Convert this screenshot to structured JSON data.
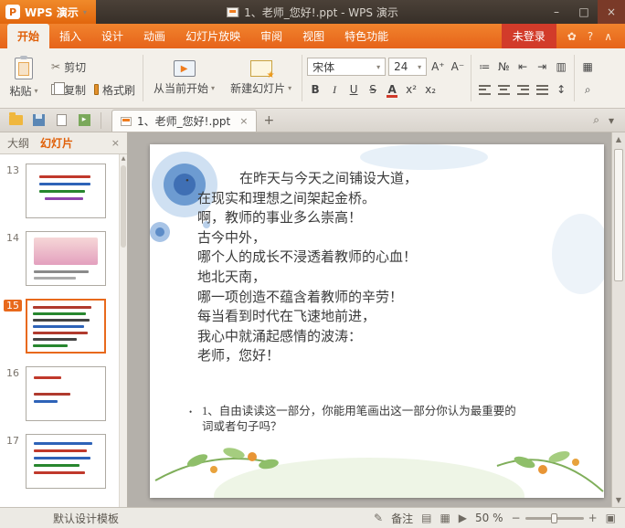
{
  "titlebar": {
    "logo_text": "WPS 演示",
    "title": "1、老师_您好!.ppt - WPS 演示"
  },
  "window": {
    "minimize": "–",
    "maximize": "□",
    "close": "×"
  },
  "ribbon_tabs": {
    "items": [
      "开始",
      "插入",
      "设计",
      "动画",
      "幻灯片放映",
      "审阅",
      "视图",
      "特色功能"
    ],
    "login": "未登录"
  },
  "toolbar": {
    "paste": "粘贴",
    "cut": "剪切",
    "copy": "复制",
    "format_painter": "格式刷",
    "from_current": "从当前开始",
    "new_slide": "新建幻灯片",
    "font_name": "宋体",
    "font_size": "24"
  },
  "glyphs": {
    "logo_p": "P",
    "caret_down": "▾",
    "collapse": "∧",
    "skin": "✿",
    "help": "?",
    "cut": "✂",
    "play": "▶",
    "font_bigger": "A⁺",
    "font_smaller": "A⁻",
    "bold": "B",
    "italic": "I",
    "underline": "U",
    "strike": "S",
    "font_color": "A",
    "superscript": "x²",
    "subscript": "x₂",
    "bullets": "≔",
    "numbering": "№",
    "indent_dec": "⇤",
    "indent_inc": "⇥",
    "columns": "▥",
    "line_spacing": "↕",
    "layout": "▦",
    "find": "⌕",
    "scroll_up": "▲",
    "scroll_down": "▼",
    "notes": "✎",
    "view_normal": "▤",
    "view_sorter": "▦",
    "view_play": "▶",
    "zoom_minus": "−",
    "zoom_plus": "+",
    "fit": "▣",
    "new_tab": "+",
    "close_small": "×",
    "export_arrow": "▸"
  },
  "docbar": {
    "tab_title": "1、老师_您好!.ppt"
  },
  "sidebar": {
    "tab_outline": "大纲",
    "tab_slides": "幻灯片",
    "close": "×",
    "thumbnails": [
      {
        "number": "13"
      },
      {
        "number": "14"
      },
      {
        "number": "15"
      },
      {
        "number": "16"
      },
      {
        "number": "17"
      }
    ]
  },
  "slide": {
    "bullet": "•",
    "lines": [
      "在昨天与今天之间铺设大道，",
      "在现实和理想之间架起金桥。",
      "啊，教师的事业多么崇高！",
      "古今中外，",
      "哪个人的成长不浸透着教师的心血！",
      "地北天南，",
      "哪一项创造不蕴含着教师的辛劳！",
      "每当看到时代在飞速地前进，",
      "我心中就涌起感情的波涛：",
      "老师，您好！"
    ],
    "question_bullet": "•",
    "question_lines": [
      "1、自由读读这一部分，你能用笔画出这一部分你认为最重要的",
      "词或者句子吗？"
    ]
  },
  "statusbar": {
    "template": "默认设计模板",
    "notes_label": "备注",
    "zoom": "50 %"
  },
  "colors": {
    "accent": "#e8691c",
    "tab_orange": "#ec6e1f",
    "login_red": "#d23b2a"
  }
}
